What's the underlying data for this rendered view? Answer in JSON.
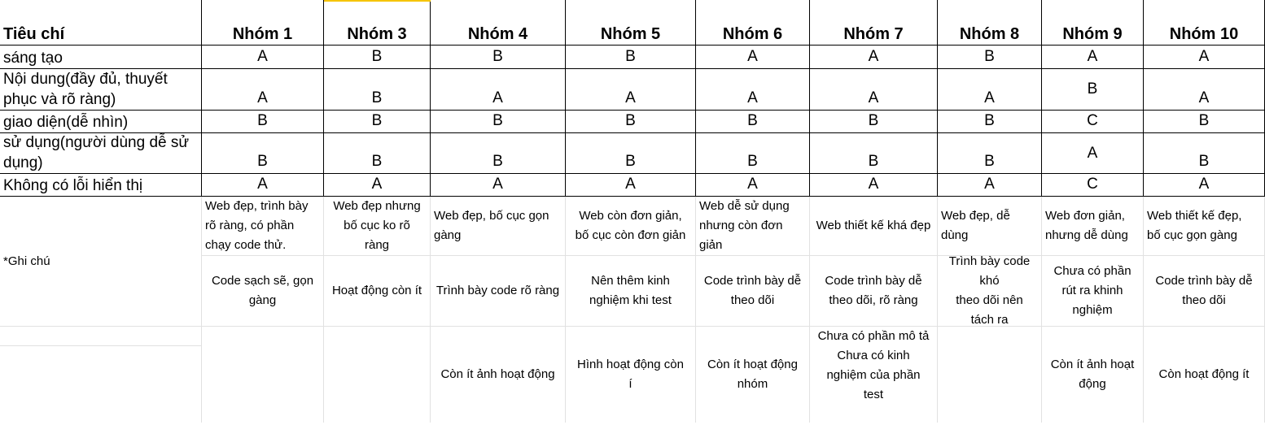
{
  "header": {
    "criteria": "Tiêu chí",
    "groups": [
      "Nhóm 1",
      "Nhóm 3",
      "Nhóm 4",
      "Nhóm 5",
      "Nhóm 6",
      "Nhóm 7",
      "Nhóm 8",
      "Nhóm 9",
      "Nhóm 10"
    ]
  },
  "criteria": [
    {
      "label": "sáng tạo",
      "grades": [
        "A",
        "B",
        "B",
        "B",
        "A",
        "A",
        "B",
        "A",
        "A"
      ]
    },
    {
      "label": "Nội dung(đầy đủ, thuyết\nphục và rõ ràng)",
      "grades": [
        "A",
        "B",
        "A",
        "A",
        "A",
        "A",
        "A",
        "B",
        "A"
      ]
    },
    {
      "label": "giao diện(dễ nhìn)",
      "grades": [
        "B",
        "B",
        "B",
        "B",
        "B",
        "B",
        "B",
        "C",
        "B"
      ]
    },
    {
      "label": "sử dụng(người dùng dễ sử\ndụng)",
      "grades": [
        "B",
        "B",
        "B",
        "B",
        "B",
        "B",
        "B",
        "A",
        "B"
      ]
    },
    {
      "label": "Không có lỗi hiển thị",
      "grades": [
        "A",
        "A",
        "A",
        "A",
        "A",
        "A",
        "A",
        "C",
        "A"
      ]
    }
  ],
  "notes_label": "*Ghi chú",
  "notes": {
    "row1": [
      "Web đẹp, trình bày\nrõ ràng, có phần\nchạy code thử.",
      "Web đẹp nhưng\nbố cục ko rõ\nràng",
      "Web đẹp, bố cục gọn\ngàng",
      "Web còn đơn giản,\nbố cục còn đơn giản",
      "Web dễ sử dụng\nnhưng còn đơn\ngiản",
      "Web thiết kế khá đẹp",
      "Web đẹp, dễ\ndùng",
      "Web đơn giản,\nnhưng dễ dùng",
      "Web thiết kế đẹp,\nbố cục gọn gàng"
    ],
    "row2": [
      "Code sạch sẽ, gọn\ngàng",
      "Hoạt động còn ít",
      "Trình bày code rõ ràng",
      "Nên thêm kinh\nnghiệm khi test",
      "Code trình bày dễ\ntheo dõi",
      "Code trình bày dễ\ntheo dõi, rõ ràng",
      "Trình bày code\nkhó\ntheo dõi nên\ntách ra",
      "Chưa có phần\nrút ra khinh\nnghiệm",
      "Code trình bày dễ\ntheo dõi"
    ],
    "row3": [
      "",
      "",
      "Còn ít ảnh hoạt động",
      "Hình hoạt động còn\ní",
      "Còn ít hoạt động\nnhóm",
      "Chưa có phần mô tả\nChưa có kinh\nnghiệm của phần\ntest",
      "",
      "Còn ít ảnh hoạt\nđộng",
      "Còn hoạt động ít"
    ]
  }
}
